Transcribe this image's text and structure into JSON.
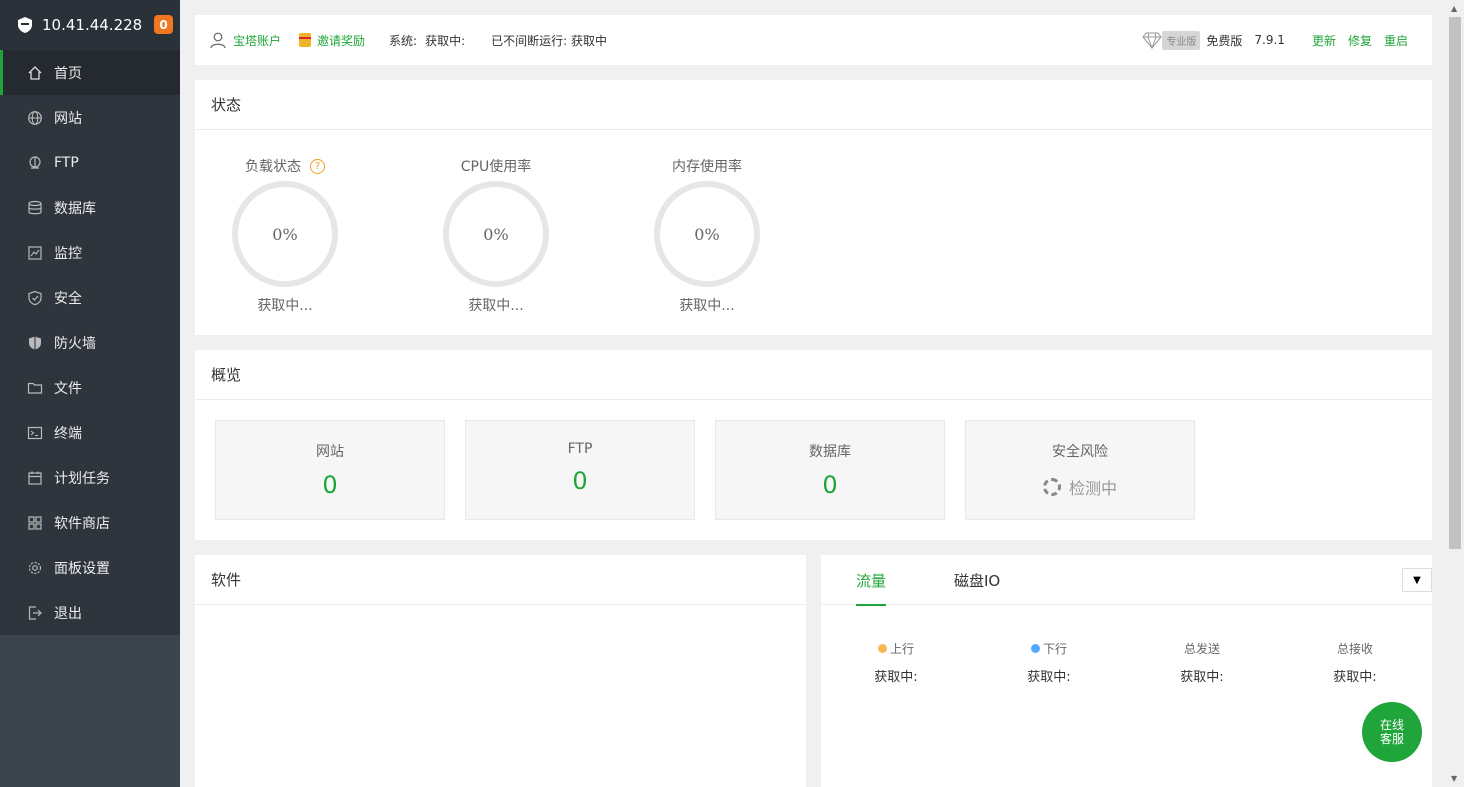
{
  "sidebar": {
    "ip": "10.41.44.228",
    "badge": "0",
    "items": [
      {
        "label": "首页",
        "icon": "home-icon"
      },
      {
        "label": "网站",
        "icon": "globe-icon"
      },
      {
        "label": "FTP",
        "icon": "ftp-icon"
      },
      {
        "label": "数据库",
        "icon": "database-icon"
      },
      {
        "label": "监控",
        "icon": "monitor-icon"
      },
      {
        "label": "安全",
        "icon": "shield-icon"
      },
      {
        "label": "防火墙",
        "icon": "firewall-icon"
      },
      {
        "label": "文件",
        "icon": "folder-icon"
      },
      {
        "label": "终端",
        "icon": "terminal-icon"
      },
      {
        "label": "计划任务",
        "icon": "calendar-icon"
      },
      {
        "label": "软件商店",
        "icon": "apps-icon"
      },
      {
        "label": "面板设置",
        "icon": "gear-icon"
      },
      {
        "label": "退出",
        "icon": "logout-icon"
      }
    ]
  },
  "topbar": {
    "account": "宝塔账户",
    "invite": "邀请奖励",
    "system_label": "系统:",
    "system_value": "获取中:",
    "uptime": "已不间断运行: 获取中",
    "pro_tag": "专业版",
    "free": "免费版",
    "version": "7.9.1",
    "update": "更新",
    "repair": "修复",
    "restart": "重启"
  },
  "status": {
    "title": "状态",
    "gauges": [
      {
        "title": "负载状态",
        "value": "0%",
        "sub": "获取中...",
        "help": "?"
      },
      {
        "title": "CPU使用率",
        "value": "0%",
        "sub": "获取中..."
      },
      {
        "title": "内存使用率",
        "value": "0%",
        "sub": "获取中..."
      }
    ]
  },
  "overview": {
    "title": "概览",
    "boxes": [
      {
        "label": "网站",
        "value": "0"
      },
      {
        "label": "FTP",
        "value": "0"
      },
      {
        "label": "数据库",
        "value": "0"
      },
      {
        "label": "安全风险",
        "value": "检测中"
      }
    ]
  },
  "software": {
    "title": "软件"
  },
  "traffic": {
    "tabs": [
      "流量",
      "磁盘IO"
    ],
    "dropdown": "▼",
    "stats": [
      {
        "label": "上行",
        "value": "获取中:",
        "color": "#f7b851"
      },
      {
        "label": "下行",
        "value": "获取中:",
        "color": "#52a9ff"
      },
      {
        "label": "总发送",
        "value": "获取中:"
      },
      {
        "label": "总接收",
        "value": "获取中:"
      }
    ]
  },
  "service": {
    "line1": "在线",
    "line2": "客服"
  },
  "colors": {
    "accent": "#20a53a",
    "sidebar": "#3c444d",
    "badge": "#f0771f"
  }
}
